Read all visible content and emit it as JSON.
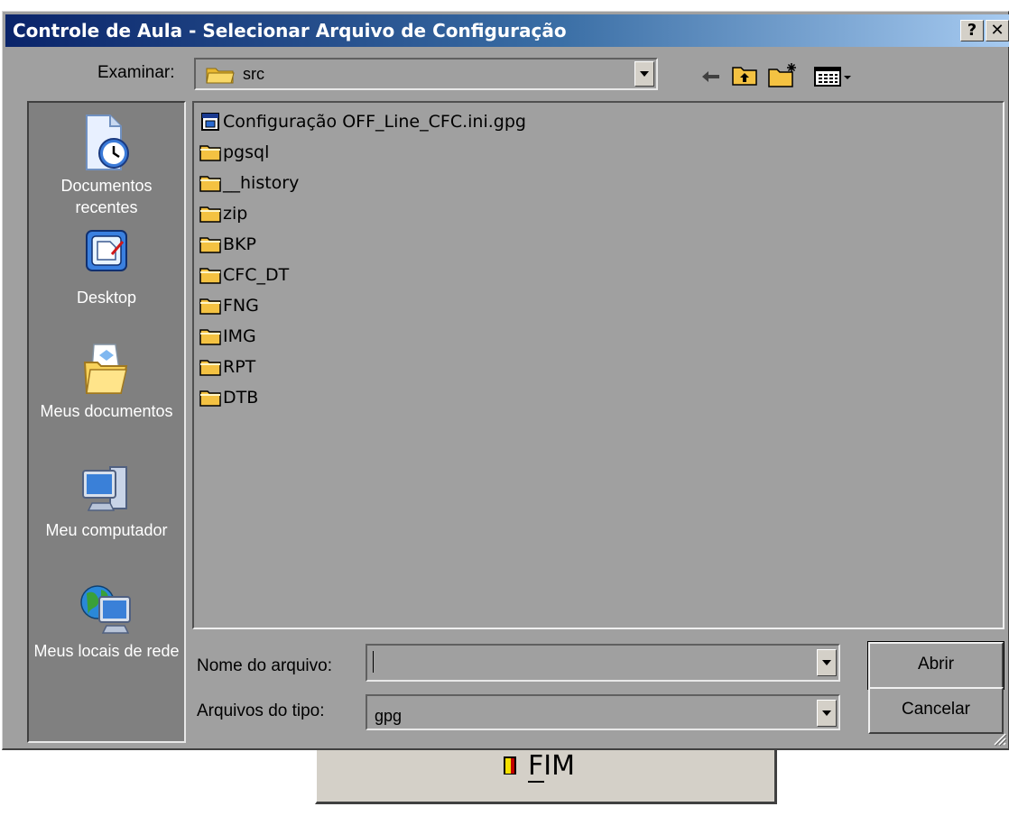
{
  "window": {
    "title": "Controle de Aula - Selecionar Arquivo de Configuração",
    "help_label": "?",
    "close_label": "✕"
  },
  "toolbar": {
    "look_in_label": "Examinar:",
    "look_in_value": "src"
  },
  "places": [
    {
      "label": "Documentos recentes",
      "icon": "recent-documents-icon"
    },
    {
      "label": "Desktop",
      "icon": "desktop-icon"
    },
    {
      "label": "Meus documentos",
      "icon": "my-documents-icon"
    },
    {
      "label": "Meu computador",
      "icon": "my-computer-icon"
    },
    {
      "label": "Meus locais de rede",
      "icon": "network-places-icon"
    }
  ],
  "files": [
    {
      "name": "Configuração OFF_Line_CFC.ini.gpg",
      "type": "file"
    },
    {
      "name": "pgsql",
      "type": "folder"
    },
    {
      "name": "__history",
      "type": "folder"
    },
    {
      "name": "zip",
      "type": "folder"
    },
    {
      "name": "BKP",
      "type": "folder"
    },
    {
      "name": "CFC_DT",
      "type": "folder"
    },
    {
      "name": "FNG",
      "type": "folder"
    },
    {
      "name": "IMG",
      "type": "folder"
    },
    {
      "name": "RPT",
      "type": "folder"
    },
    {
      "name": "DTB",
      "type": "folder"
    }
  ],
  "form": {
    "filename_label": "Nome do arquivo:",
    "filename_value": "",
    "filetype_label": "Arquivos do tipo:",
    "filetype_value": "gpg",
    "open_label": "Abrir",
    "cancel_label": "Cancelar"
  },
  "background": {
    "fim_label": "FIM"
  },
  "colors": {
    "title_start": "#0a246a",
    "title_end": "#a6caf0",
    "folder": "#f4c242",
    "dialog_bg": "#a0a0a0",
    "places_bg": "#808080"
  }
}
